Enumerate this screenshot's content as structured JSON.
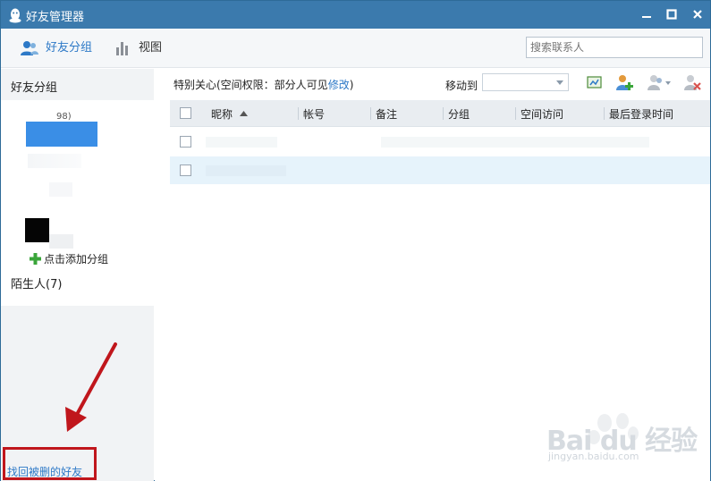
{
  "window": {
    "title": "好友管理器",
    "controls": {
      "minimize": "—",
      "maximize": "■",
      "close": "✕"
    }
  },
  "toolbar": {
    "groups_label": "好友分组",
    "view_label": "视图",
    "search_placeholder": "搜索联系人"
  },
  "sidebar": {
    "header": "好友分组",
    "group_count_fragment": "98)",
    "add_group_label": "点击添加分组",
    "strangers_label": "陌生人(7)",
    "recover_link": "找回被删的好友"
  },
  "main": {
    "care_label_prefix": "特别关心(空间权限：部分人可见",
    "care_edit_link": "修改",
    "care_label_suffix": ")",
    "move_to_label": "移动到",
    "move_to_value": ""
  },
  "table": {
    "columns": [
      "昵称",
      "帐号",
      "备注",
      "分组",
      "空间访问",
      "最后登录时间"
    ],
    "sort_column": "昵称",
    "sort_direction": "asc",
    "rows": [
      {
        "selected": false,
        "highlighted": false
      },
      {
        "selected": false,
        "highlighted": true
      }
    ]
  },
  "watermark": {
    "brand": "Bai du 经验",
    "url": "jingyan.baidu.com"
  },
  "colors": {
    "titlebar": "#3b7aad",
    "accent": "#2d79c7",
    "annotation_red": "#c0161c",
    "row_highlight": "#e6f3fb"
  }
}
